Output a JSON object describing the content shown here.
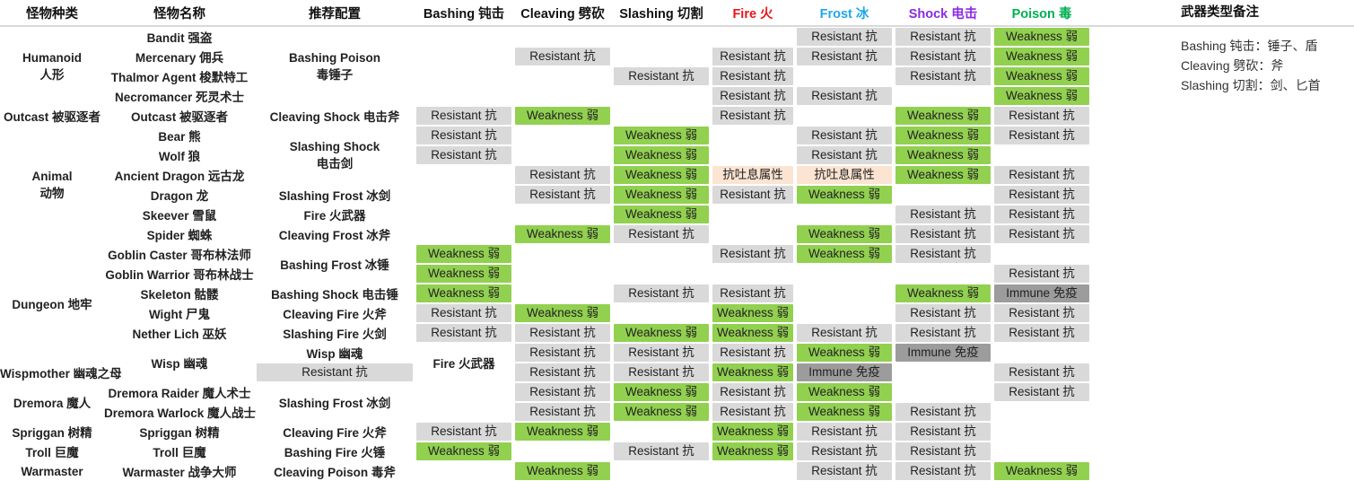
{
  "table": {
    "headers": [
      {
        "label": "怪物种类",
        "key": "kind",
        "color": "#111111"
      },
      {
        "label": "怪物名称",
        "key": "name",
        "color": "#111111"
      },
      {
        "label": "推荐配置",
        "key": "build",
        "color": "#111111"
      },
      {
        "label": "Bashing 钝击",
        "key": "bashing",
        "color": "#111111"
      },
      {
        "label": "Cleaving 劈砍",
        "key": "cleaving",
        "color": "#111111"
      },
      {
        "label": "Slashing 切割",
        "key": "slashing",
        "color": "#111111"
      },
      {
        "label": "Fire 火",
        "key": "fire",
        "color": "#e8161a"
      },
      {
        "label": "Frost 冰",
        "key": "frost",
        "color": "#1ea8ec"
      },
      {
        "label": "Shock 电击",
        "key": "shock",
        "color": "#8a2be2"
      },
      {
        "label": "Poison 毒",
        "key": "poison",
        "color": "#00b050"
      }
    ],
    "states": {
      "res": "Resistant 抗",
      "weak": "Weakness 弱",
      "imm": "Immune 免疫",
      "breath": "抗吐息属性",
      "none": ""
    },
    "state_colors": {
      "res": "#d9d9d9",
      "weak": "#92d050",
      "imm": "#9c9c9c",
      "breath": "#fce4d2",
      "none": "#ffffff"
    },
    "rows": [
      {
        "kind": "Humanoid\n人形",
        "kind_rowspan": 4,
        "kind_color": "black",
        "name": "Bandit 强盗",
        "name_color": "green",
        "build": "Bashing Poison\n毒锤子",
        "build_rowspan": 4,
        "build_color": "green",
        "cells": [
          "none",
          "none",
          "none",
          "none",
          "res",
          "res",
          "weak"
        ]
      },
      {
        "name": "Mercenary 佣兵",
        "name_color": "green",
        "cells": [
          "none",
          "res",
          "none",
          "res",
          "res",
          "res",
          "weak"
        ]
      },
      {
        "name": "Thalmor Agent 梭默特工",
        "name_color": "green",
        "cells": [
          "none",
          "none",
          "res",
          "res",
          "none",
          "res",
          "weak"
        ]
      },
      {
        "name": "Necromancer 死灵术士",
        "name_color": "green",
        "cells": [
          "none",
          "none",
          "none",
          "res",
          "res",
          "none",
          "weak"
        ]
      },
      {
        "kind": "Outcast 被驱逐者",
        "kind_rowspan": 1,
        "kind_color": "black",
        "name": "Outcast 被驱逐者",
        "name_color": "purple",
        "build": "Cleaving Shock 电击斧",
        "build_rowspan": 1,
        "build_color": "purple",
        "cells": [
          "res",
          "weak",
          "none",
          "res",
          "none",
          "weak",
          "res"
        ]
      },
      {
        "kind": "Animal\n动物",
        "kind_rowspan": 6,
        "kind_color": "black",
        "name": "Bear 熊",
        "name_color": "purple",
        "build": "Slashing Shock\n电击剑",
        "build_rowspan": 3,
        "build_color": "purple",
        "cells": [
          "res",
          "none",
          "weak",
          "none",
          "res",
          "weak",
          "res"
        ]
      },
      {
        "name": "Wolf 狼",
        "name_color": "purple",
        "cells": [
          "res",
          "none",
          "weak",
          "none",
          "res",
          "weak",
          "none"
        ]
      },
      {
        "name": "Ancient Dragon 远古龙",
        "name_color": "purple",
        "cells": [
          "none",
          "res",
          "weak",
          "breath",
          "breath",
          "weak",
          "res"
        ]
      },
      {
        "name": "Dragon 龙",
        "name_color": "blue",
        "build": "Slashing Frost 冰剑",
        "build_rowspan": 1,
        "build_color": "blue",
        "cells": [
          "none",
          "res",
          "weak",
          "res",
          "weak",
          "none",
          "res"
        ]
      },
      {
        "name": "Skeever 雪鼠",
        "name_color": "red",
        "build": "Fire 火武器",
        "build_rowspan": 1,
        "build_color": "red",
        "cells": [
          "none",
          "none",
          "weak",
          "none",
          "none",
          "res",
          "res"
        ]
      },
      {
        "name": "Spider 蜘蛛",
        "name_color": "blue",
        "build": "Cleaving Frost 冰斧",
        "build_rowspan": 1,
        "build_color": "blue",
        "cells": [
          "none",
          "weak",
          "res",
          "none",
          "weak",
          "res",
          "res"
        ]
      },
      {
        "kind": "Dungeon 地牢",
        "kind_rowspan": 6,
        "kind_color": "black",
        "name": "Goblin Caster 哥布林法师",
        "name_color": "blue",
        "build": "Bashing Frost 冰锤",
        "build_rowspan": 2,
        "build_color": "blue",
        "cells": [
          "weak",
          "none",
          "none",
          "res",
          "weak",
          "res",
          "none"
        ]
      },
      {
        "name": "Goblin Warrior 哥布林战士",
        "name_color": "blue",
        "cells": [
          "weak",
          "none",
          "none",
          "none",
          "none",
          "none",
          "res"
        ]
      },
      {
        "name": "Skeleton 骷髅",
        "name_color": "purple",
        "build": "Bashing Shock 电击锤",
        "build_rowspan": 1,
        "build_color": "purple",
        "cells": [
          "weak",
          "none",
          "res",
          "res",
          "none",
          "weak",
          "imm"
        ]
      },
      {
        "name": "Wight 尸鬼",
        "name_color": "red",
        "build": "Cleaving Fire 火斧",
        "build_rowspan": 1,
        "build_color": "red",
        "cells": [
          "res",
          "weak",
          "none",
          "weak",
          "none",
          "res",
          "res"
        ]
      },
      {
        "name": "Nether Lich 巫妖",
        "name_color": "red",
        "build": "Slashing Fire 火剑",
        "build_rowspan": 1,
        "build_color": "red",
        "cells": [
          "res",
          "res",
          "weak",
          "weak",
          "res",
          "res",
          "res"
        ]
      },
      {
        "kind": "Wisp 幽魂",
        "kind_rowspan": 2,
        "kind_color": "black",
        "name": "Wisp 幽魂",
        "name_color": "red",
        "build": "Fire 火武器",
        "build_rowspan": 2,
        "build_color": "red",
        "cells": [
          "res",
          "res",
          "res",
          "weak",
          "imm",
          "none",
          "res"
        ]
      },
      {
        "name": "Wispmother 幽魂之母",
        "name_color": "red",
        "cells": [
          "res",
          "res",
          "res",
          "weak",
          "imm",
          "none",
          "res"
        ]
      },
      {
        "kind": "Dremora 魔人",
        "kind_rowspan": 2,
        "kind_color": "black",
        "name": "Dremora Raider 魔人术士",
        "name_color": "blue",
        "build": "Slashing Frost 冰剑",
        "build_rowspan": 2,
        "build_color": "blue",
        "cells": [
          "none",
          "res",
          "weak",
          "res",
          "weak",
          "none",
          "res"
        ]
      },
      {
        "name": "Dremora Warlock 魔人战士",
        "name_color": "blue",
        "cells": [
          "none",
          "res",
          "weak",
          "res",
          "weak",
          "res",
          "none"
        ]
      },
      {
        "kind": "Spriggan 树精",
        "kind_rowspan": 1,
        "kind_color": "black",
        "name": "Spriggan 树精",
        "name_color": "red",
        "build": "Cleaving Fire 火斧",
        "build_rowspan": 1,
        "build_color": "red",
        "cells": [
          "res",
          "weak",
          "none",
          "weak",
          "res",
          "res",
          "none"
        ]
      },
      {
        "kind": "Troll 巨魔",
        "kind_rowspan": 1,
        "kind_color": "black",
        "name": "Troll 巨魔",
        "name_color": "red",
        "build": "Bashing Fire 火锤",
        "build_rowspan": 1,
        "build_color": "red",
        "cells": [
          "weak",
          "none",
          "res",
          "weak",
          "res",
          "res",
          "none"
        ]
      },
      {
        "kind": "Warmaster",
        "kind_rowspan": 1,
        "kind_color": "black",
        "name": "Warmaster 战争大师",
        "name_color": "green",
        "build": "Cleaving Poison 毒斧",
        "build_rowspan": 1,
        "build_color": "green",
        "cells": [
          "none",
          "weak",
          "none",
          "none",
          "res",
          "res",
          "weak"
        ]
      }
    ]
  },
  "notes": {
    "title": "武器类型备注",
    "lines": [
      "Bashing 钝击：锤子、盾",
      "Cleaving 劈砍：斧",
      "Slashing 切割：剑、匕首"
    ]
  }
}
